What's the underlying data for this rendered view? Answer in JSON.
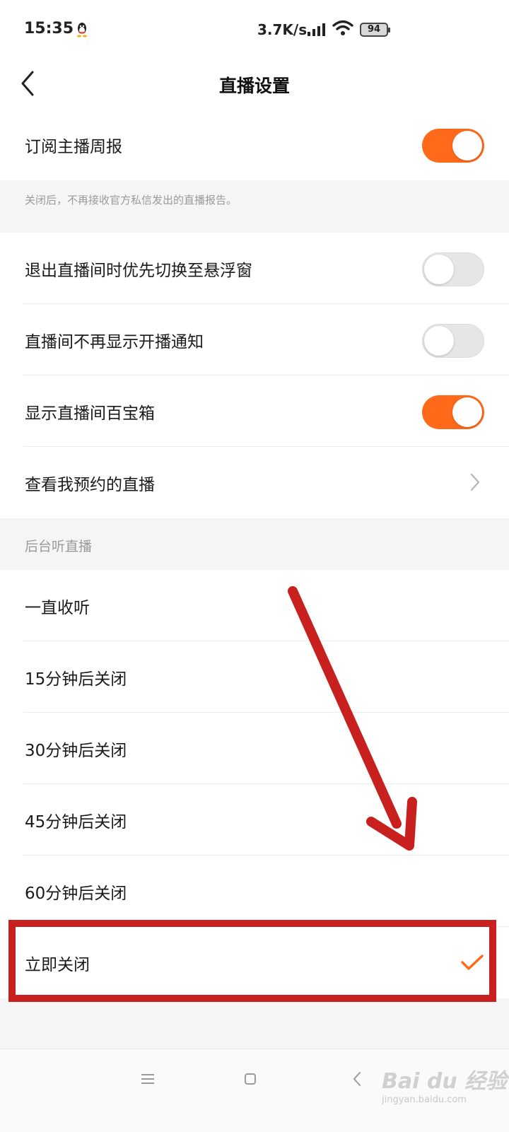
{
  "status_bar": {
    "time": "15:35",
    "speed": "3.7K/s",
    "battery": "94",
    "icons": [
      "qq-icon",
      "signal-icon",
      "wifi-icon",
      "battery-icon"
    ]
  },
  "nav": {
    "title": "直播设置",
    "back_icon": "chevron-left-icon"
  },
  "settings": {
    "weekly_report": {
      "label": "订阅主播周报",
      "enabled": true
    },
    "weekly_report_note": "关闭后，不再接收官方私信发出的直播报告。",
    "float_window": {
      "label": "退出直播间时优先切换至悬浮窗",
      "enabled": false
    },
    "hide_notice": {
      "label": "直播间不再显示开播通知",
      "enabled": false
    },
    "toolbox": {
      "label": "显示直播间百宝箱",
      "enabled": true
    },
    "reservations": {
      "label": "查看我预约的直播"
    }
  },
  "background_listen": {
    "header": "后台听直播",
    "options": [
      {
        "label": "一直收听",
        "selected": false
      },
      {
        "label": "15分钟后关闭",
        "selected": false
      },
      {
        "label": "30分钟后关闭",
        "selected": false
      },
      {
        "label": "45分钟后关闭",
        "selected": false
      },
      {
        "label": "60分钟后关闭",
        "selected": false
      },
      {
        "label": "立即关闭",
        "selected": true
      }
    ]
  },
  "colors": {
    "accent": "#ff6a1a",
    "annotation": "#c8201f"
  },
  "watermark": {
    "logo": "Bai du 经验",
    "url": "jingyan.baidu.com"
  }
}
